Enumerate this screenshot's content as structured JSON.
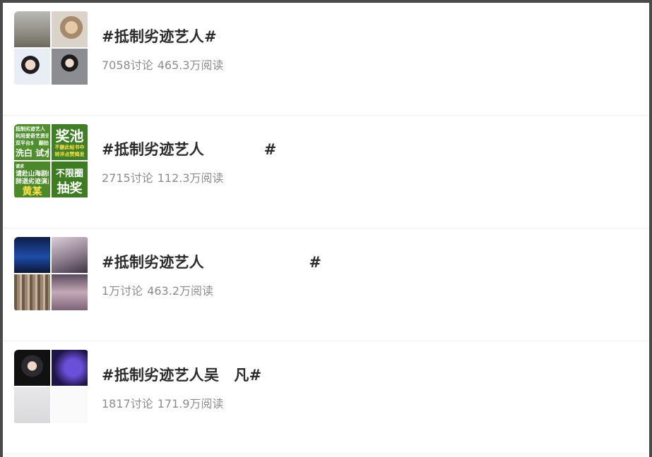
{
  "topics": [
    {
      "title": "#抵制劣迹艺人#",
      "discussions": "7058讨论",
      "reads": "465.3万阅读",
      "thumb_style": "photos"
    },
    {
      "title": "#抵制劣迹艺人　　　　#",
      "discussions": "2715讨论",
      "reads": "112.3万阅读",
      "thumb_style": "green-text",
      "thumb_text": {
        "a_lines": [
          "抵制劣迹艺人",
          "利用爱奇艺资讯",
          "双平台$　翻拍",
          "洗白 试水"
        ],
        "b_big": "奖池",
        "b_small": [
          "不删此帖书中",
          "转评点赞揭发"
        ],
        "c_lines": [
          "请求",
          "请赴山海剧组",
          "辞退劣迹演员",
          "黄某"
        ],
        "d_lines": [
          "不限圈",
          "抽奖"
        ]
      }
    },
    {
      "title": "#抵制劣迹艺人　　　　　　　#",
      "discussions": "1万讨论",
      "reads": "463.2万阅读",
      "thumb_style": "concert"
    },
    {
      "title": "#抵制劣迹艺人吴　凡#",
      "discussions": "1817讨论",
      "reads": "171.9万阅读",
      "thumb_style": "portrait"
    }
  ]
}
